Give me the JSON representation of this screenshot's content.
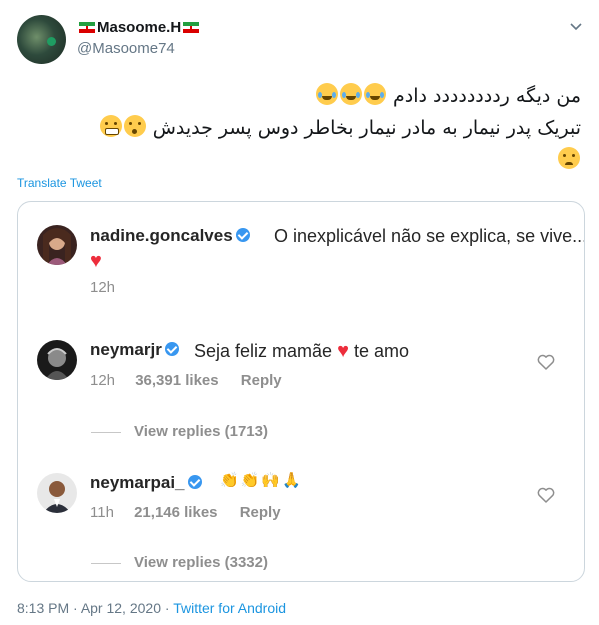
{
  "author": {
    "name": "Masoome.H",
    "handle": "@Masoome74",
    "flag_icon": "iran-flag-icon",
    "caret_icon": "chevron-down-icon"
  },
  "tweet": {
    "line1": "من دیگه ردددددددد دادم",
    "line2": "تبریک پدر نیمار به مادر نیمار بخاطر دوس پسر جدیدش",
    "emoji_line1": [
      "face-with-tears-of-joy",
      "face-with-tears-of-joy",
      "face-with-tears-of-joy"
    ],
    "emoji_line2": [
      "flushed-face",
      "grimacing-face",
      "woozy-face"
    ],
    "translate_label": "Translate Tweet"
  },
  "embedded": {
    "comments": [
      {
        "user": "nadine.goncalves",
        "verified": true,
        "text": "O inexplicável não se explica, se vive...",
        "emoji": "red-heart",
        "time": "12h"
      },
      {
        "user": "neymarjr",
        "verified": true,
        "text_before": "Seja feliz mamãe",
        "text_after": "te amo",
        "emoji": "red-heart",
        "time": "12h",
        "likes": "36,391 likes",
        "reply": "Reply",
        "view_replies": "View replies (1713)"
      },
      {
        "user": "neymarpai_",
        "verified": true,
        "emoji": [
          "clapping-hands",
          "clapping-hands",
          "raising-hands",
          "folded-hands"
        ],
        "time": "11h",
        "likes": "21,146 likes",
        "reply": "Reply",
        "view_replies": "View replies (3332)"
      }
    ]
  },
  "footer": {
    "time": "8:13 PM",
    "sep1": " · ",
    "date": "Apr 12, 2020",
    "sep2": " · ",
    "source": "Twitter for Android"
  },
  "colors": {
    "link": "#1b95e0",
    "muted": "#657786",
    "ig_verified": "#3897f0",
    "heart": "#ed2d3c"
  }
}
